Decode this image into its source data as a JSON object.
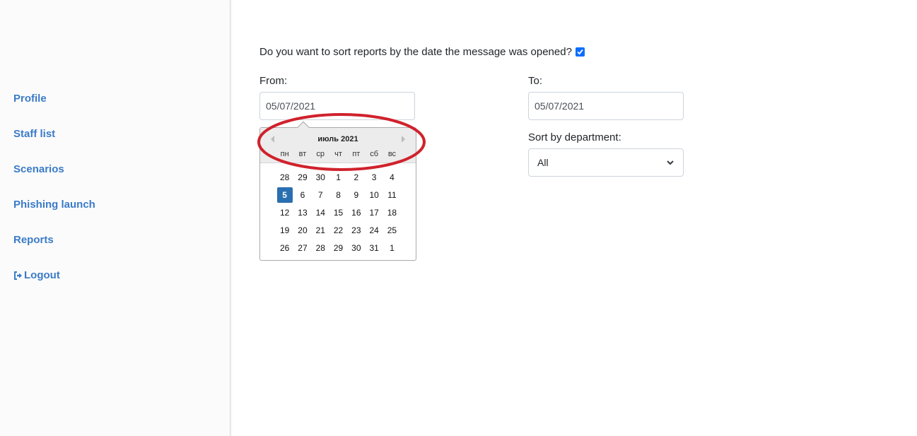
{
  "sidebar": {
    "items": [
      {
        "label": "Profile"
      },
      {
        "label": "Staff list"
      },
      {
        "label": "Scenarios"
      },
      {
        "label": "Phishing launch"
      },
      {
        "label": "Reports"
      },
      {
        "label": "Logout",
        "icon": "logout-icon"
      }
    ]
  },
  "form": {
    "question": "Do you want to sort reports by the date the message was opened?",
    "checkbox_checked": true,
    "from_label": "From:",
    "from_value": "05/07/2021",
    "to_label": "To:",
    "to_value": "05/07/2021",
    "department_label": "Sort by department:",
    "department_value": "All"
  },
  "datepicker": {
    "month": "июль 2021",
    "weekdays": [
      "пн",
      "вт",
      "ср",
      "чт",
      "пт",
      "сб",
      "вс"
    ],
    "days": [
      "28",
      "29",
      "30",
      "1",
      "2",
      "3",
      "4",
      "5",
      "6",
      "7",
      "8",
      "9",
      "10",
      "11",
      "12",
      "13",
      "14",
      "15",
      "16",
      "17",
      "18",
      "19",
      "20",
      "21",
      "22",
      "23",
      "24",
      "25",
      "26",
      "27",
      "28",
      "29",
      "30",
      "31",
      "1"
    ],
    "selected_index": 7
  },
  "colors": {
    "link": "#3a7bc8",
    "selected_day": "#2a6fb0",
    "annotation": "#d0222c",
    "checkbox": "#0d6efd"
  }
}
